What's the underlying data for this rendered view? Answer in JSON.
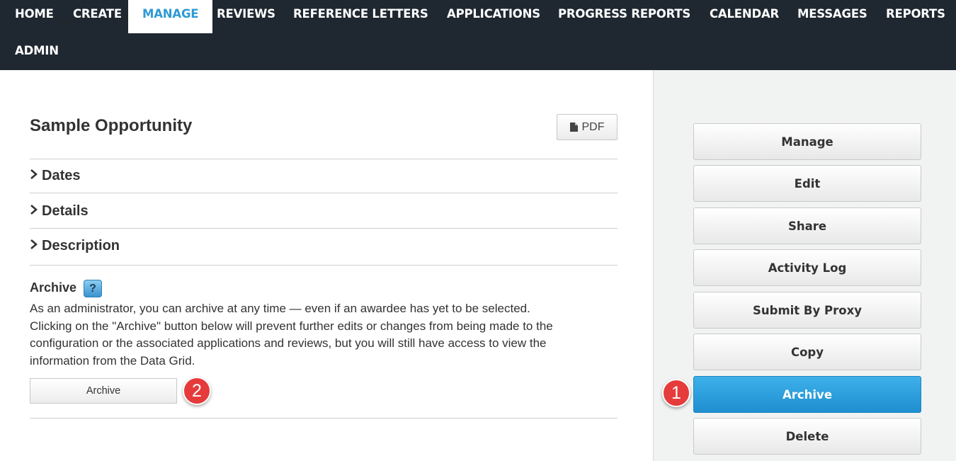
{
  "nav": {
    "items": [
      "HOME",
      "CREATE",
      "MANAGE",
      "REVIEWS",
      "REFERENCE LETTERS",
      "APPLICATIONS",
      "PROGRESS REPORTS",
      "CALENDAR",
      "MESSAGES",
      "REPORTS",
      "ADMIN"
    ],
    "active": "MANAGE"
  },
  "page": {
    "title": "Sample Opportunity",
    "pdf_label": "PDF",
    "sections": [
      "Dates",
      "Details",
      "Description"
    ]
  },
  "archive": {
    "heading": "Archive",
    "help_label": "?",
    "description": "As an administrator, you can archive at any time — even if an awardee has yet to be selected. Clicking on the \"Archive\" button below will prevent further edits or changes from being made to the configuration or the associated applications and reviews, but you will still have access to view the information from the Data Grid.",
    "button_label": "Archive"
  },
  "sidebar": {
    "buttons": [
      "Manage",
      "Edit",
      "Share",
      "Activity Log",
      "Submit By Proxy",
      "Copy",
      "Archive",
      "Delete"
    ],
    "highlighted": "Archive"
  },
  "callouts": [
    "1",
    "2"
  ],
  "colors": {
    "nav_bg": "#1f2730",
    "accent": "#2e9ad4",
    "callout": "#e63b3b",
    "sidebar_bg": "#f1f3f2"
  }
}
